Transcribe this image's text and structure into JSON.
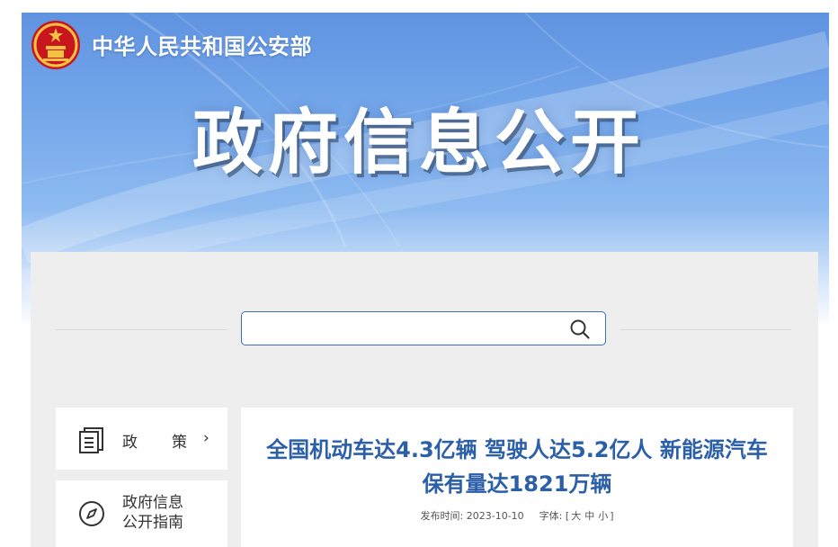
{
  "header": {
    "ministry_name": "中华人民共和国公安部",
    "section_title": "政府信息公开",
    "emblem_icon": "national-emblem-icon"
  },
  "search": {
    "value": "",
    "placeholder": "",
    "icon": "search-icon"
  },
  "sidebar": {
    "items": [
      {
        "label_chars": [
          "政",
          "策"
        ],
        "icon": "document-icon",
        "chevron": "›"
      },
      {
        "label_line1": "政府信息",
        "label_line2": "公开指南",
        "icon": "compass-icon"
      }
    ]
  },
  "article": {
    "title_line1": "全国机动车达4.3亿辆 驾驶人达5.2亿人 新能源汽车",
    "title_line2": "保有量达1821万辆",
    "publish_label": "发布时间:",
    "publish_date": "2023-10-10",
    "font_label": "字体:",
    "bracket_open": "[",
    "font_large": "大",
    "font_medium": "中",
    "font_small": "小",
    "bracket_close": "]"
  },
  "colors": {
    "banner_blue": "#6a9fe6",
    "title_blue": "#2b5fa8",
    "panel_gray": "#eeeeee",
    "search_border": "#3a6fc0"
  }
}
